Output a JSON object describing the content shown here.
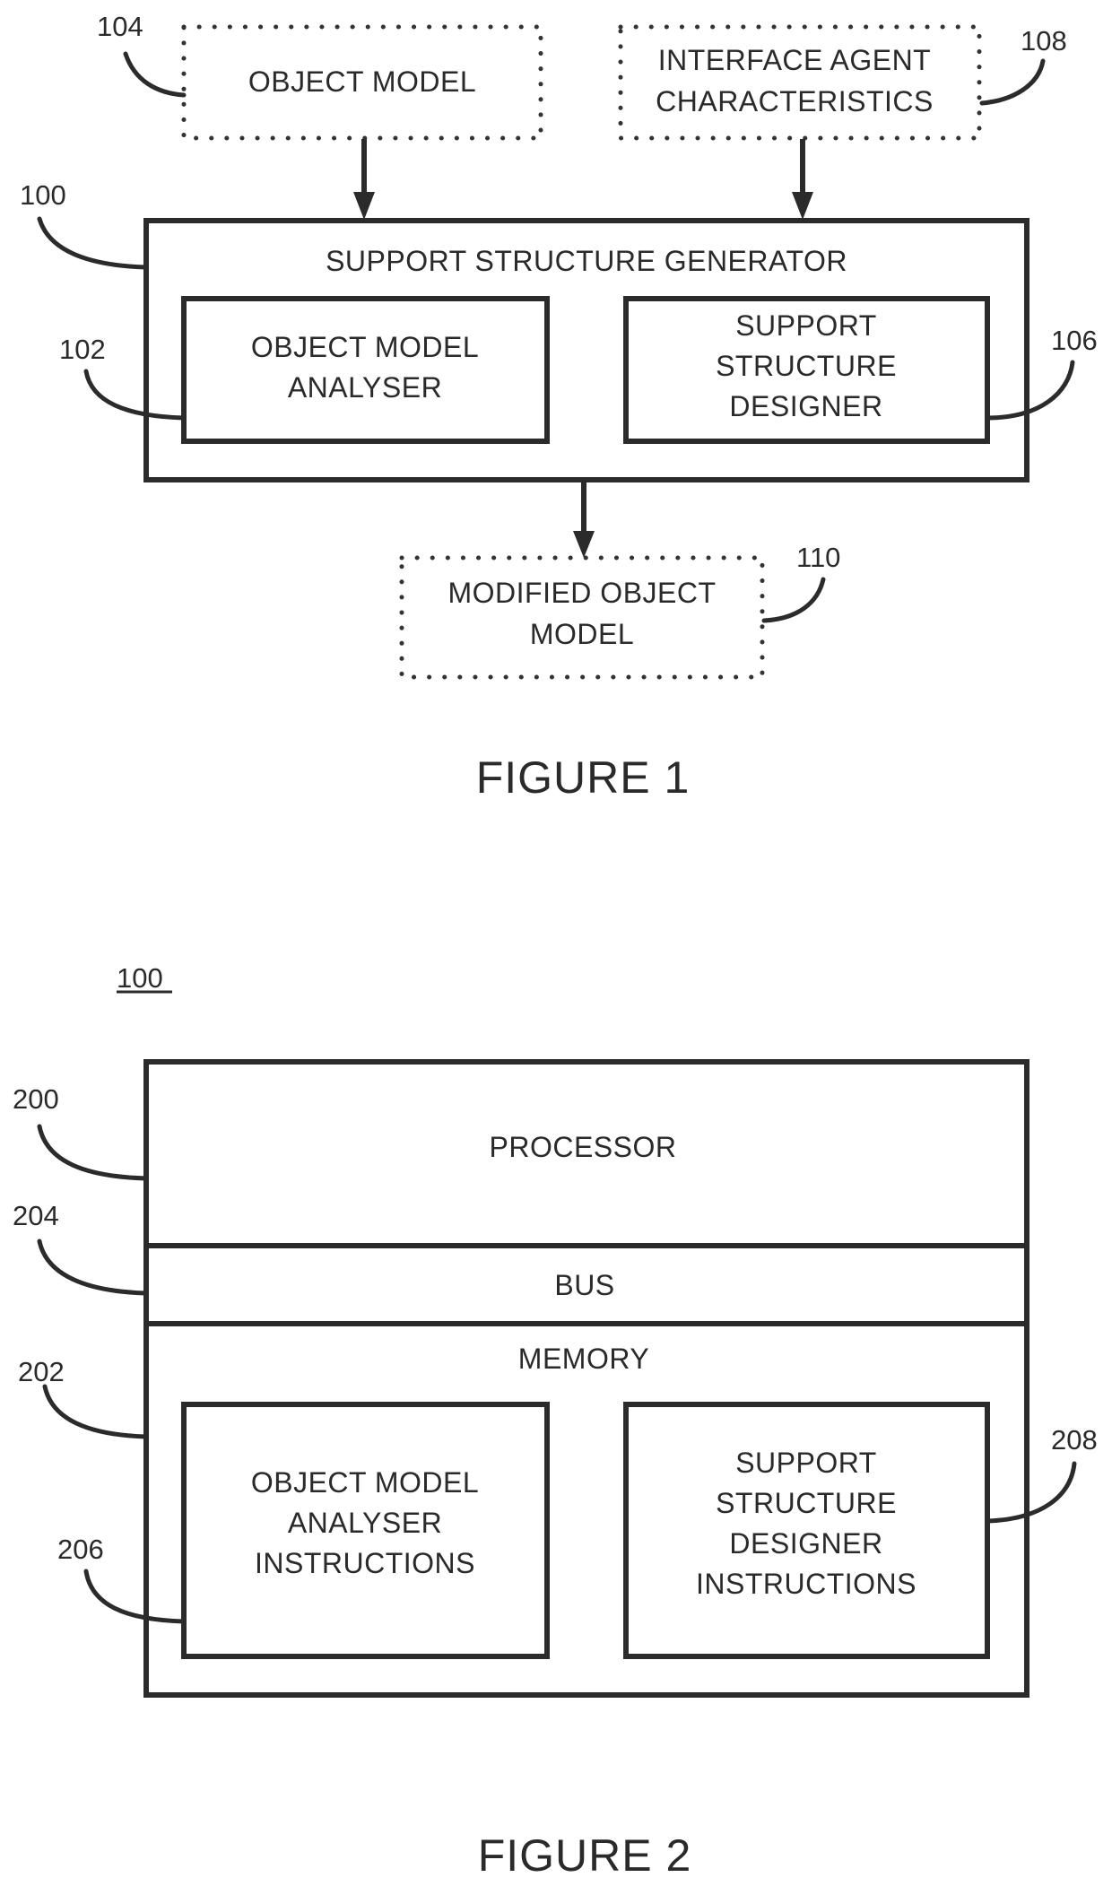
{
  "figure1": {
    "caption": "FIGURE 1",
    "object_model": {
      "ref": "104",
      "lines": [
        "OBJECT MODEL"
      ]
    },
    "interface_agent": {
      "ref": "108",
      "lines": [
        "INTERFACE AGENT",
        "CHARACTERISTICS"
      ]
    },
    "generator": {
      "ref": "100",
      "title": "SUPPORT STRUCTURE GENERATOR"
    },
    "analyser": {
      "ref": "102",
      "lines": [
        "OBJECT MODEL",
        "ANALYSER"
      ]
    },
    "designer": {
      "ref": "106",
      "lines": [
        "SUPPORT",
        "STRUCTURE",
        "DESIGNER"
      ]
    },
    "modified": {
      "ref": "110",
      "lines": [
        "MODIFIED OBJECT",
        "MODEL"
      ]
    }
  },
  "figure2": {
    "caption": "FIGURE 2",
    "system_ref": "100",
    "processor": {
      "ref": "200",
      "label": "PROCESSOR"
    },
    "bus": {
      "ref": "204",
      "label": "BUS"
    },
    "memory": {
      "ref": "202",
      "label": "MEMORY"
    },
    "analyser_instructions": {
      "ref": "206",
      "lines": [
        "OBJECT MODEL",
        "ANALYSER",
        "INSTRUCTIONS"
      ]
    },
    "designer_instructions": {
      "ref": "208",
      "lines": [
        "SUPPORT",
        "STRUCTURE",
        "DESIGNER",
        "INSTRUCTIONS"
      ]
    }
  }
}
